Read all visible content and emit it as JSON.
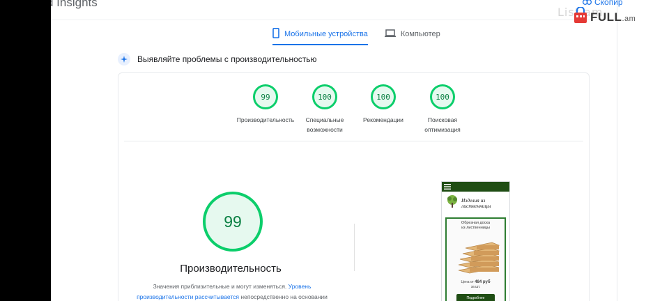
{
  "app_title": "d Insights",
  "copy_link": "Скопир",
  "watermark": "List.am",
  "brand": {
    "name": "FULL",
    "domain": ".am"
  },
  "tabs": [
    {
      "label": "Мобильные устройства",
      "icon": "mobile-phone-icon",
      "active": true
    },
    {
      "label": "Компьютер",
      "icon": "laptop-icon",
      "active": false
    }
  ],
  "section_title": "Выявляйте проблемы с производительностью",
  "gauges": [
    {
      "score": "99",
      "label_line1": "Производительность",
      "label_line2": ""
    },
    {
      "score": "100",
      "label_line1": "Специальные",
      "label_line2": "возможности"
    },
    {
      "score": "100",
      "label_line1": "Рекомендации",
      "label_line2": ""
    },
    {
      "score": "100",
      "label_line1": "Поисковая",
      "label_line2": "оптимизация"
    }
  ],
  "main_score": {
    "score": "99",
    "title": "Производительность",
    "note_part1": "Значения приблизительные и могут изменяться.",
    "note_link1": "Уровень",
    "note_link2": "производительности рассчитывается",
    "note_part2": "непосредственно на основании"
  },
  "preview": {
    "site_title_line1": "Изделия из",
    "site_title_line2": "лиственницы",
    "box_title_line1": "Обрезная доска",
    "box_title_line2": "из лиственницы",
    "price_prefix": "Цена от",
    "price_value": "484 руб",
    "price_unit": "за шт.",
    "button_label": "Подробнее"
  },
  "colors": {
    "pass_green": "#0cce6b",
    "pass_text": "#0b8043",
    "accent_blue": "#1a73e8",
    "site_dark_green": "#1f4d14"
  }
}
